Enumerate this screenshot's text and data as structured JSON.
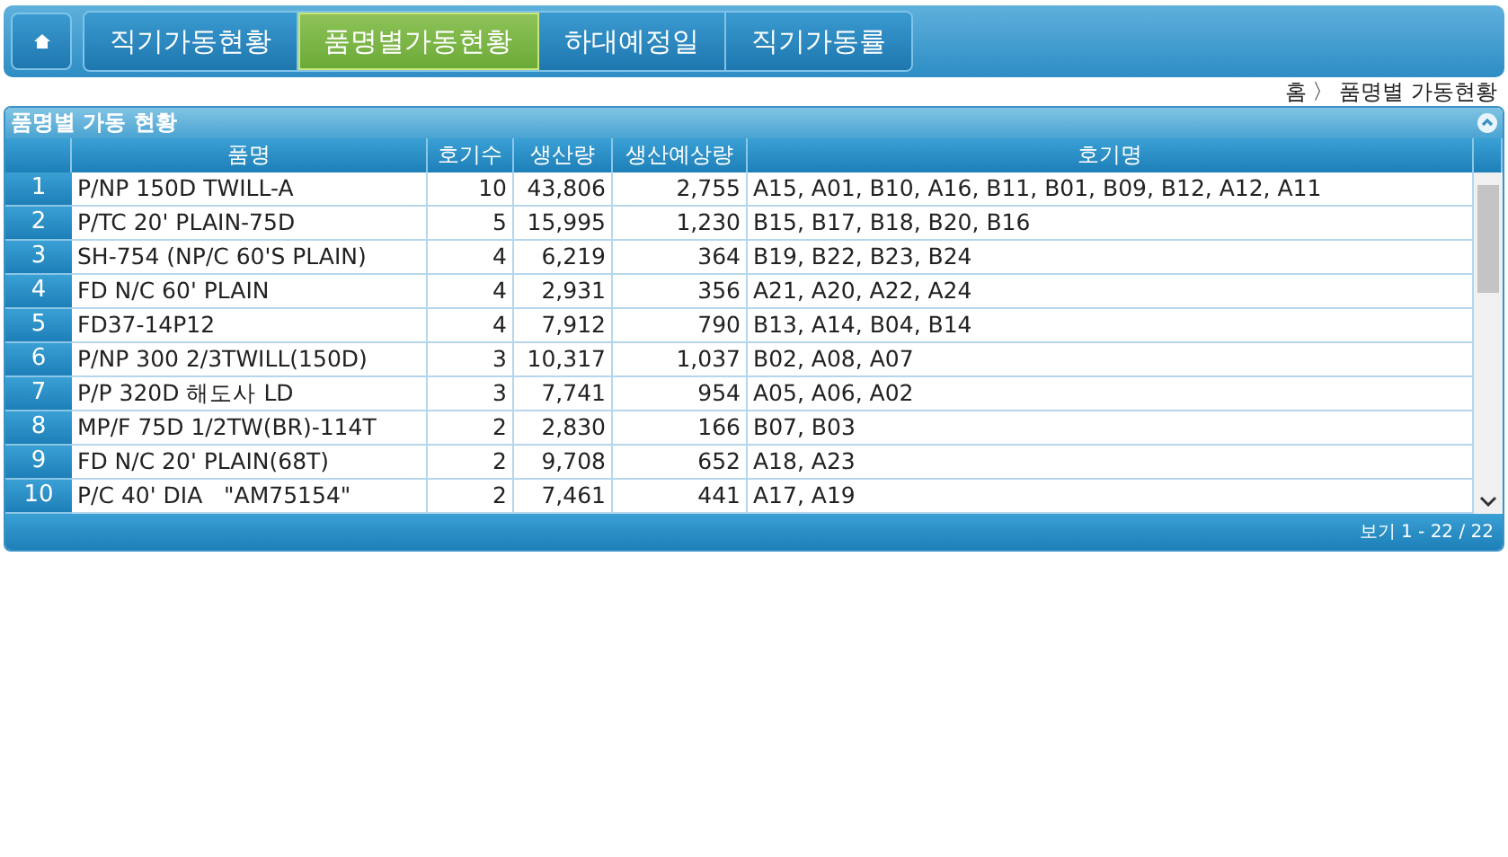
{
  "nav": {
    "tabs": [
      {
        "label": "직기가동현황",
        "selected": false
      },
      {
        "label": "품명별가동현황",
        "selected": true
      },
      {
        "label": "하대예정일",
        "selected": false
      },
      {
        "label": "직기가동률",
        "selected": false
      }
    ]
  },
  "breadcrumb": {
    "home": "홈",
    "separator": "〉",
    "current": "품명별 가동현황"
  },
  "panel": {
    "title": "품명별 가동 현황",
    "table": {
      "columns": [
        "",
        "품명",
        "호기수",
        "생산량",
        "생산예상량",
        "호기명"
      ],
      "rows": [
        [
          "1",
          "P/NP 150D TWILL-A",
          "10",
          "43,806",
          "2,755",
          "A15, A01, B10, A16, B11, B01, B09, B12, A12, A11"
        ],
        [
          "2",
          "P/TC 20' PLAIN-75D",
          "5",
          "15,995",
          "1,230",
          "B15, B17, B18, B20, B16"
        ],
        [
          "3",
          "SH-754 (NP/C 60'S PLAIN)",
          "4",
          "6,219",
          "364",
          "B19, B22, B23, B24"
        ],
        [
          "4",
          "FD N/C 60' PLAIN",
          "4",
          "2,931",
          "356",
          "A21, A20, A22, A24"
        ],
        [
          "5",
          "FD37-14P12",
          "4",
          "7,912",
          "790",
          "B13, A14, B04, B14"
        ],
        [
          "6",
          "P/NP 300 2/3TWILL(150D)",
          "3",
          "10,317",
          "1,037",
          "B02, A08, A07"
        ],
        [
          "7",
          "P/P 320D 해도사 LD",
          "3",
          "7,741",
          "954",
          "A05, A06, A02"
        ],
        [
          "8",
          "MP/F 75D 1/2TW(BR)-114T",
          "2",
          "2,830",
          "166",
          "B07, B03"
        ],
        [
          "9",
          "FD N/C 20' PLAIN(68T)",
          "2",
          "9,708",
          "652",
          "A18, A23"
        ],
        [
          "10",
          "P/C 40' DIA   \"AM75154\"",
          "2",
          "7,461",
          "441",
          "A17, A19"
        ]
      ]
    },
    "pager": "보기 1 - 22 / 22"
  }
}
